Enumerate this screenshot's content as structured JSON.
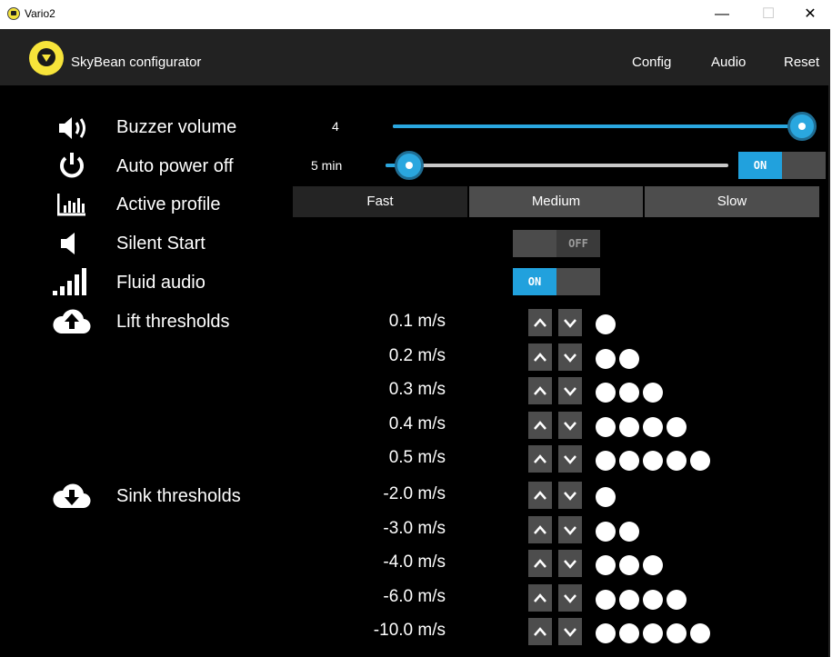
{
  "window": {
    "title": "Vario2",
    "minimize": "—",
    "maximize": "☐",
    "close": "✕"
  },
  "app": {
    "title": "SkyBean configurator",
    "nav": {
      "config": "Config",
      "audio": "Audio",
      "reset": "Reset"
    }
  },
  "settings": {
    "buzzer_volume": {
      "label": "Buzzer volume",
      "value": "4",
      "level": 1.0,
      "icon": "speaker-volume-icon"
    },
    "auto_power_off": {
      "label": "Auto power off",
      "value": "5 min",
      "level": 0.0,
      "toggle": "ON",
      "icon": "power-icon"
    },
    "active_profile": {
      "label": "Active profile",
      "options": [
        "Fast",
        "Medium",
        "Slow"
      ],
      "selected": "Fast",
      "icon": "bar-chart-icon"
    },
    "silent_start": {
      "label": "Silent Start",
      "toggle": "OFF",
      "icon": "speaker-icon"
    },
    "fluid_audio": {
      "label": "Fluid audio",
      "toggle": "ON",
      "icon": "signal-bars-icon"
    }
  },
  "lift_thresholds": {
    "label": "Lift thresholds",
    "icon": "cloud-upload-icon",
    "values": [
      "0.1 m/s",
      "0.2 m/s",
      "0.3 m/s",
      "0.4 m/s",
      "0.5 m/s"
    ],
    "dots": [
      1,
      2,
      3,
      4,
      5
    ]
  },
  "sink_thresholds": {
    "label": "Sink thresholds",
    "icon": "cloud-download-icon",
    "values": [
      "-2.0 m/s",
      "-3.0 m/s",
      "-4.0 m/s",
      "-6.0 m/s",
      "-10.0 m/s"
    ],
    "dots": [
      1,
      2,
      3,
      4,
      5
    ]
  },
  "colors": {
    "accent": "#2aa7df",
    "background": "#000000",
    "appbar": "#222222",
    "button": "#4d4d4d"
  }
}
